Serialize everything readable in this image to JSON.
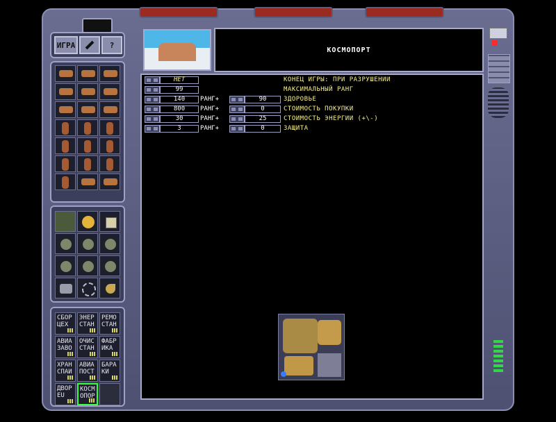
{
  "menu": {
    "game_label": "ИГРА",
    "tools_icon": "wrench-icon",
    "help_label": "?"
  },
  "header": {
    "title": "КОСМОПОРТ"
  },
  "stats": [
    {
      "value": "НЕТ",
      "rank": "",
      "rank_value": "",
      "label": "КОНЕЦ ИГРЫ: ПРИ РАЗРУШЕНИИ"
    },
    {
      "value": "99",
      "rank": "",
      "rank_value": "",
      "label": "МАКСИМАЛЬНЫЙ РАНГ"
    },
    {
      "value": "140",
      "rank": "РАНГ+",
      "rank_value": "90",
      "label": "ЗДОРОВЬЕ"
    },
    {
      "value": "800",
      "rank": "РАНГ+",
      "rank_value": "0",
      "label": "СТОИМОСТЬ ПОКУПКИ"
    },
    {
      "value": "30",
      "rank": "РАНГ+",
      "rank_value": "25",
      "label": "СТОИМОСТЬ ЭНЕРГИИ (+\\-)"
    },
    {
      "value": "3",
      "rank": "РАНГ+",
      "rank_value": "0",
      "label": "ЗАЩИТА"
    }
  ],
  "buildings": [
    {
      "line1": "СБОР",
      "line2": "ЦЕХ"
    },
    {
      "line1": "ЭНЕР",
      "line2": "СТАН"
    },
    {
      "line1": "РЕМО",
      "line2": "СТАН"
    },
    {
      "line1": "АВИА",
      "line2": "ЗАВО"
    },
    {
      "line1": "ОЧИС",
      "line2": "СТАН"
    },
    {
      "line1": "ФАБР",
      "line2": "ИКА"
    },
    {
      "line1": "ХРАН",
      "line2": "СПАИ"
    },
    {
      "line1": "АВИА",
      "line2": "ПОСТ"
    },
    {
      "line1": "БАРА",
      "line2": "КИ"
    },
    {
      "line1": "ДВОР",
      "line2": "EU"
    },
    {
      "line1": "КОСМ",
      "line2": "ОПОР"
    }
  ],
  "selected_building": "КОСМ ОПОР",
  "colors": {
    "frame": "#5a5d80",
    "text_yellow": "#f7f18d",
    "selection": "#36ff3b",
    "tab_red": "#9b2a20"
  }
}
